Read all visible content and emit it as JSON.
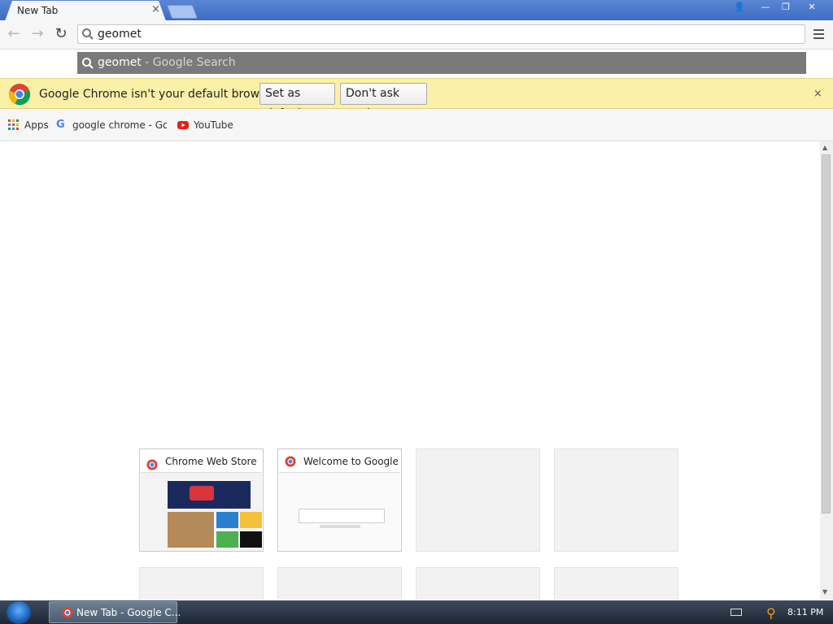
{
  "browser": {
    "tab_title": "New Tab",
    "tab_close": "×",
    "window_controls": {
      "user": "👤",
      "minimize": "—",
      "maximize": "❐",
      "close": "✕"
    }
  },
  "toolbar": {
    "back": "←",
    "forward": "→",
    "reload": "↻",
    "omnibox_value": "geomet"
  },
  "suggestion": {
    "query": "geomet",
    "suffix": " - Google Search"
  },
  "infobar": {
    "message": "Google Chrome isn't your default browser.",
    "set_default": "Set as default",
    "dont_ask": "Don't ask again",
    "close": "×"
  },
  "bookmarks": {
    "apps": "Apps",
    "item1": "google chrome - Goog",
    "item2": "YouTube"
  },
  "most_visited": {
    "tile1_title": "Chrome Web Store",
    "tile2_title": "Welcome to Google C"
  },
  "taskbar": {
    "task_label": "New Tab - Google C...",
    "clock": "8:11 PM"
  },
  "colors": {
    "titlebar": "#3e6cc4",
    "infobar": "#fbf0a8",
    "suggestion_bg": "#7a7a7a"
  }
}
